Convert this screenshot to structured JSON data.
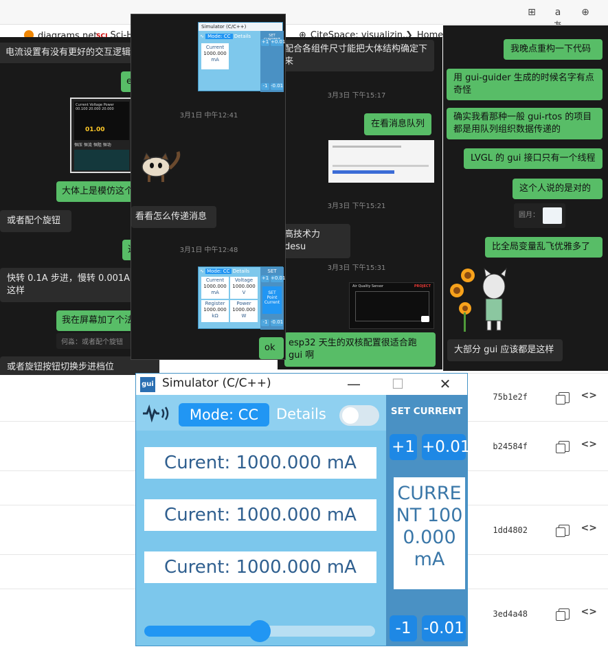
{
  "browser": {
    "bookmarks": [
      "diagrams.net",
      "Sci-H",
      "CiteSpace: visualizin...",
      "Home"
    ],
    "rows": [
      {
        "hash": "75b1e2f"
      },
      {
        "hash": "b24584f"
      },
      {
        "hash": "1dd4802"
      },
      {
        "hash": "3ed4a48"
      }
    ]
  },
  "chat1": {
    "messages": [
      "电流设置有没有更好的交互逻辑",
      "e",
      "大体上是模仿这个",
      "或者配个旋钮",
      "这",
      "快转 0.1A 步进，慢转 0.001A 步进这样",
      "我在屏幕加了个法",
      "或者旋钮按钮切换步进档位"
    ],
    "quote": "何淼：或者配个旋钮",
    "device": {
      "value": "01.00"
    }
  },
  "chat2": {
    "ts1": "3月1日 中午12:41",
    "ts2": "3月1日 中午12:48",
    "msg_look": "看看怎么传递消息",
    "msg_ok": "ok",
    "mini_top": {
      "title": "Simulator (C/C++)",
      "mode": "Mode: CC",
      "details": "Details",
      "set": "SET CURRENT",
      "current_lbl": "Current",
      "current_val": "1000.000",
      "unit": "mA",
      "p1": "+1",
      "p001": "+0.01",
      "m1": "-1",
      "m001": "-0.01"
    },
    "mini_bottom": {
      "mode": "Mode: CC",
      "details": "Details",
      "set": "SET",
      "current_lbl": "Current",
      "current_val": "1000.000",
      "current_unit": "mA",
      "voltage_lbl": "Voltage",
      "voltage_val": "1000.000",
      "voltage_unit": "V",
      "register_lbl": "Register",
      "register_val": "1000.000",
      "register_unit": "kΩ",
      "power_lbl": "Power",
      "power_val": "1000.000",
      "power_unit": "W",
      "setpoint": "SET Point Current",
      "p1": "+1",
      "p001": "+0.01",
      "m1": "-1",
      "m001": "-0.01"
    }
  },
  "chat3": {
    "msg1": "配合各组件尺寸能把大体结构确定下来",
    "ts1": "3月3日 下午15:17",
    "msg2": "在看消息队列",
    "ts2": "3月3日 下午15:21",
    "msg3": "高技术力 desu",
    "ts3": "3月3日 下午15:31",
    "msg4": "esp32 天生的双核配置很适合跑 gui 啊",
    "card_title": "Air Quality Sensor",
    "card_badge": "PROJECT"
  },
  "chat4": {
    "msg1": "我晚点重构一下代码",
    "msg2": "用 gui-guider 生成的时候名字有点奇怪",
    "msg3": "确实我看那种一般 gui-rtos 的项目都是用队列组织数据传递的",
    "msg4": "LVGL 的 gui 接口只有一个线程",
    "msg5": "这个人说的是对的",
    "quote": "圆月：",
    "msg6": "比全局变量乱飞优雅多了",
    "msg7": "大部分 gui 应该都是这样"
  },
  "sim": {
    "logo": "gui",
    "title": "Simulator (C/C++)",
    "minimize": "—",
    "maximize": "☐",
    "close": "✕",
    "mode": "Mode: CC",
    "details": "Details",
    "fields": [
      "Curent: 1000.000 mA",
      "Curent: 1000.000 mA",
      "Curent: 1000.000 mA"
    ],
    "set_label": "SET CURRENT",
    "plus1": "+1",
    "plus001": "+0.01",
    "minus1": "-1",
    "minus001": "-0.01",
    "display": "CURRENT 1000.000 mA",
    "slider_value": 0.5
  },
  "colors": {
    "accent": "#2196f3",
    "sim_bg": "#7cc7ec",
    "wechat_green": "#58bd67",
    "chat_dark": "#191919"
  }
}
